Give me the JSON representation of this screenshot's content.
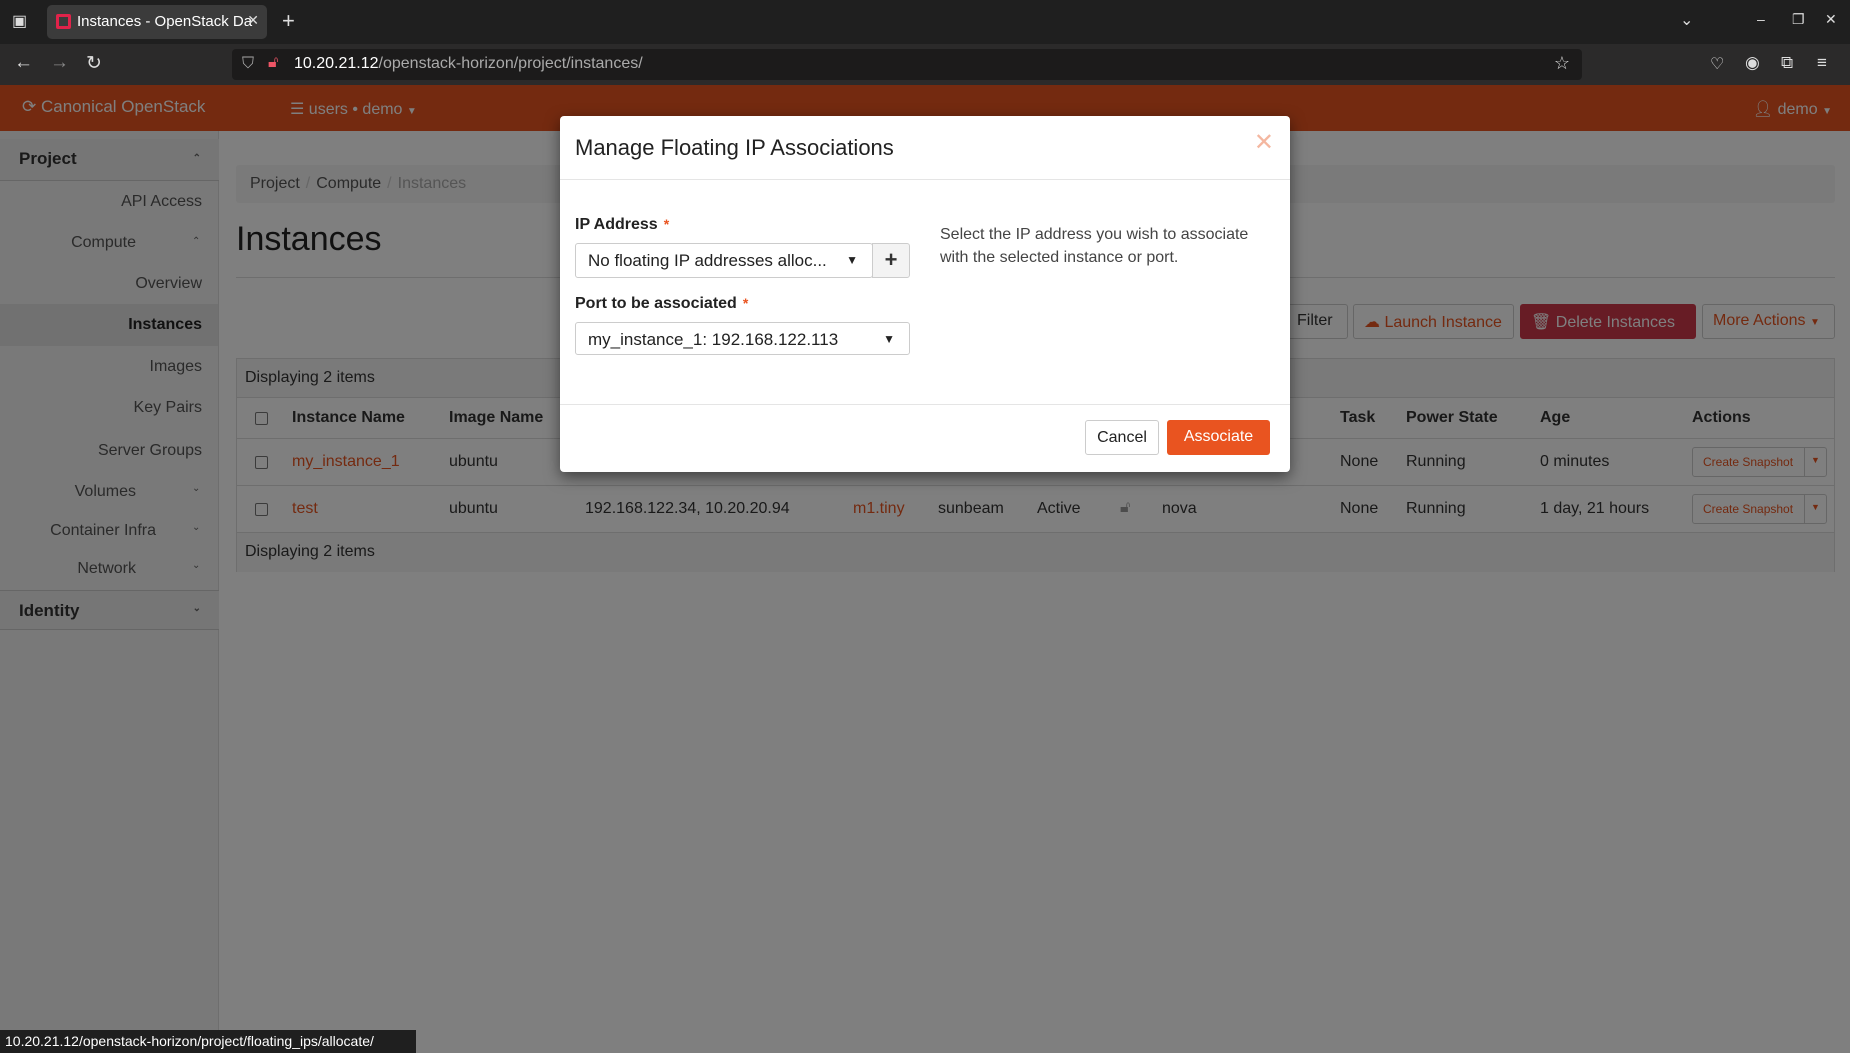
{
  "browser": {
    "tab_title": "Instances - OpenStack Da",
    "url_host": "10.20.21.12",
    "url_path": "/openstack-horizon/project/instances/",
    "status_url": "10.20.21.12/openstack-horizon/project/floating_ips/allocate/"
  },
  "header": {
    "brand": "Canonical OpenStack",
    "project_selector": "users • demo",
    "user_menu": "demo",
    "accent": "#E95420"
  },
  "sidebar": {
    "project": "Project",
    "api_access": "API Access",
    "compute": "Compute",
    "overview": "Overview",
    "instances": "Instances",
    "images": "Images",
    "key_pairs": "Key Pairs",
    "server_groups": "Server Groups",
    "volumes": "Volumes",
    "container_infra": "Container Infra",
    "network": "Network",
    "identity": "Identity"
  },
  "breadcrumb": [
    "Project",
    "Compute",
    "Instances"
  ],
  "page_title": "Instances",
  "actions": {
    "filter": "Filter",
    "launch": "Launch Instance",
    "delete": "Delete Instances",
    "more": "More Actions"
  },
  "table": {
    "count_text": "Displaying 2 items",
    "headers": {
      "name": "Instance Name",
      "image": "Image Name",
      "task": "Task",
      "power": "Power State",
      "age": "Age",
      "actions": "Actions"
    },
    "rows": [
      {
        "name": "my_instance_1",
        "image": "ubuntu",
        "ip": "",
        "flavor": "",
        "key_pair": "",
        "status": "",
        "az": "",
        "task": "None",
        "power": "Running",
        "age": "0 minutes",
        "action": "Create Snapshot"
      },
      {
        "name": "test",
        "image": "ubuntu",
        "ip": "192.168.122.34, 10.20.20.94",
        "flavor": "m1.tiny",
        "key_pair": "sunbeam",
        "status": "Active",
        "az": "nova",
        "task": "None",
        "power": "Running",
        "age": "1 day, 21 hours",
        "action": "Create Snapshot"
      }
    ]
  },
  "modal": {
    "title": "Manage Floating IP Associations",
    "ip_label": "IP Address",
    "ip_value": "No floating IP addresses alloc...",
    "port_label": "Port to be associated",
    "port_value": "my_instance_1: 192.168.122.113",
    "help": "Select the IP address you wish to associate with the selected instance or port.",
    "cancel": "Cancel",
    "associate": "Associate"
  }
}
